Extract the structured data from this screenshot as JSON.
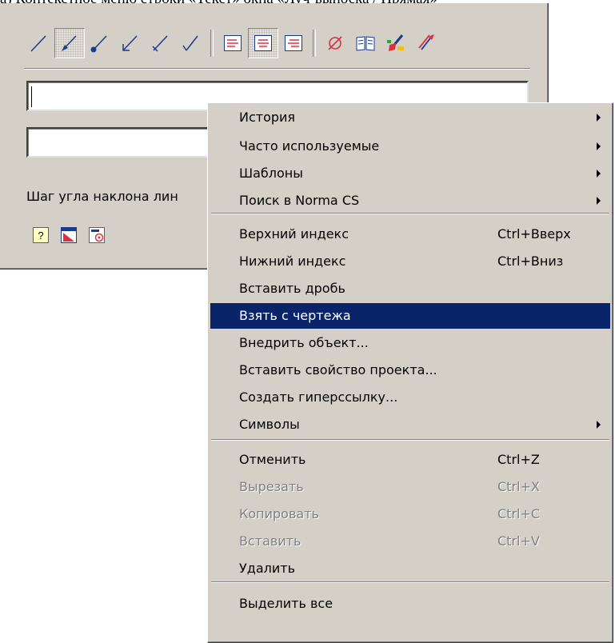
{
  "document": {
    "top_text": "а) Контекстное меню строки «Текст» окна «Луч-выноска / Прямая»"
  },
  "panel": {
    "toolbar_icons": [
      "thin-line-icon",
      "arrow-line-icon",
      "dot-line-icon",
      "arrow-line-icon",
      "tick-line-icon",
      "check-line-icon",
      "align-left-icon",
      "align-center-icon",
      "align-right-icon",
      "diameter-symbol-icon",
      "book-icon",
      "brush-icon",
      "brush-arrow-icon"
    ],
    "pressed_index": 1,
    "field1_value": "",
    "field2_value": "",
    "step_label": "Шаг угла наклона лин",
    "small_icons": [
      "help-icon",
      "draw-settings-icon",
      "text-settings-icon"
    ]
  },
  "menu": {
    "items": [
      {
        "label": "История",
        "shortcut": "",
        "submenu": true,
        "disabled": false
      },
      {
        "label": "Часто используемые",
        "shortcut": "",
        "submenu": true,
        "disabled": false
      },
      {
        "label": "Шаблоны",
        "shortcut": "",
        "submenu": true,
        "disabled": false
      },
      {
        "label": "Поиск в Norma CS",
        "shortcut": "",
        "submenu": true,
        "disabled": false
      },
      {
        "label": "Верхний индекс",
        "shortcut": "Ctrl+Вверх",
        "submenu": false,
        "disabled": false
      },
      {
        "label": "Нижний индекс",
        "shortcut": "Ctrl+Вниз",
        "submenu": false,
        "disabled": false
      },
      {
        "label": "Вставить дробь",
        "shortcut": "",
        "submenu": false,
        "disabled": false
      },
      {
        "label": "Взять с чертежа",
        "shortcut": "",
        "submenu": false,
        "disabled": false,
        "highlighted": true
      },
      {
        "label": "Внедрить объект...",
        "shortcut": "",
        "submenu": false,
        "disabled": false
      },
      {
        "label": "Вставить свойство проекта...",
        "shortcut": "",
        "submenu": false,
        "disabled": false
      },
      {
        "label": "Создать гиперссылку...",
        "shortcut": "",
        "submenu": false,
        "disabled": false
      },
      {
        "label": "Символы",
        "shortcut": "",
        "submenu": true,
        "disabled": false
      },
      {
        "label": "Отменить",
        "shortcut": "Ctrl+Z",
        "submenu": false,
        "disabled": false
      },
      {
        "label": "Вырезать",
        "shortcut": "Ctrl+X",
        "submenu": false,
        "disabled": true
      },
      {
        "label": "Копировать",
        "shortcut": "Ctrl+C",
        "submenu": false,
        "disabled": true
      },
      {
        "label": "Вставить",
        "shortcut": "Ctrl+V",
        "submenu": false,
        "disabled": true
      },
      {
        "label": "Удалить",
        "shortcut": "",
        "submenu": false,
        "disabled": false
      },
      {
        "label": "Выделить все",
        "shortcut": "",
        "submenu": false,
        "disabled": false
      }
    ]
  },
  "colors": {
    "face": "#d4d0c8",
    "highlight": "#0a246a",
    "disabled_text": "#808080",
    "accent_blue": "#1a3c8c",
    "accent_red": "#e03040"
  }
}
